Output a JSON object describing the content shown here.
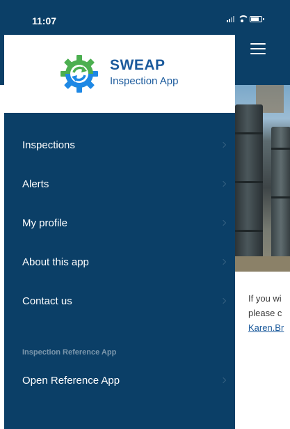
{
  "status_bar": {
    "time": "11:07"
  },
  "brand": {
    "name": "SWEAP",
    "subtitle": "Inspection App"
  },
  "menu": {
    "items": [
      {
        "label": "Inspections"
      },
      {
        "label": "Alerts"
      },
      {
        "label": "My profile"
      },
      {
        "label": "About this app"
      },
      {
        "label": "Contact us"
      }
    ],
    "section_label": "Inspection Reference App",
    "reference_item": {
      "label": "Open Reference App"
    }
  },
  "background_content": {
    "line1": "If you wi",
    "line2": "please c",
    "link": "Karen.Br"
  },
  "colors": {
    "drawer_bg": "#0b3f67",
    "brand_blue": "#1b5a9c",
    "gear_green": "#4caf50",
    "gear_blue": "#1e88e5"
  },
  "icons": [
    "hamburger-icon",
    "signal-icon",
    "wifi-icon",
    "battery-icon",
    "sweap-gear-logo",
    "chevron-right-icon"
  ]
}
